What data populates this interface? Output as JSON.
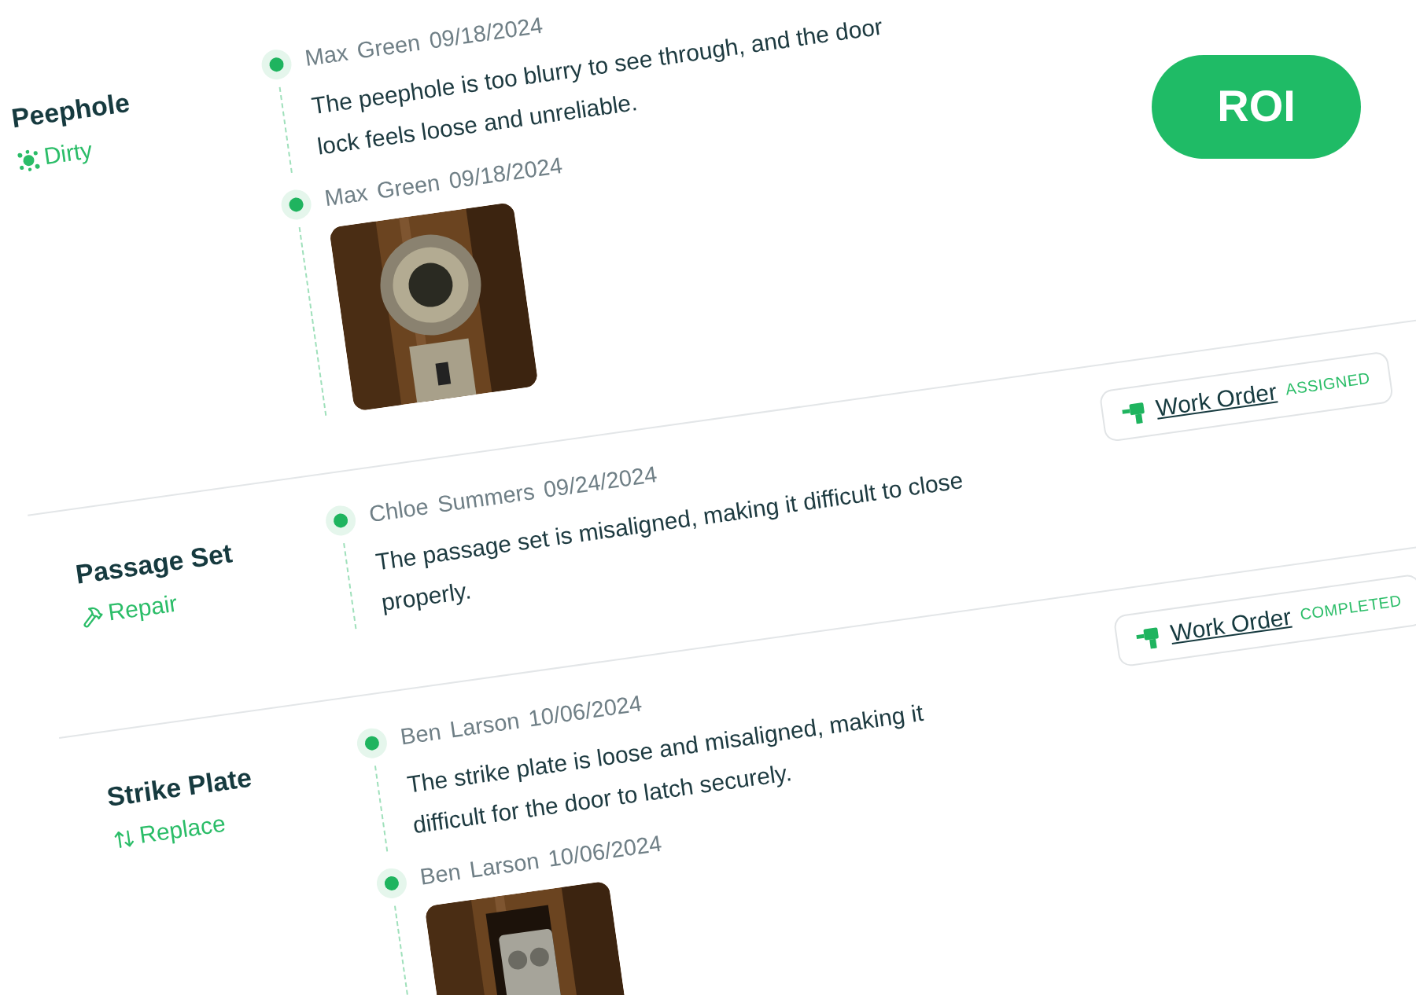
{
  "roi_button": {
    "label": "ROI"
  },
  "rows": [
    {
      "name": "Peephole",
      "tag": {
        "kind": "dirty",
        "label": "Dirty"
      },
      "entries": [
        {
          "kind": "comment",
          "author": "Max Green",
          "date": "09/18/2024",
          "text": "The peephole is too blurry to see through, and the door lock feels loose and unreliable."
        },
        {
          "author": "Max Green",
          "date": "09/18/2024"
        }
      ]
    },
    {
      "name": "Passage Set",
      "tag": {
        "kind": "repair",
        "label": "Repair"
      },
      "work_order": {
        "label": "Work Order",
        "status": "ASSIGNED"
      },
      "entries": [
        {
          "kind": "comment",
          "author": "Chloe Summers",
          "date": "09/24/2024",
          "text": "The passage set is misaligned, making it difficult to close properly."
        }
      ]
    },
    {
      "name": "Strike Plate",
      "tag": {
        "kind": "replace",
        "label": "Replace"
      },
      "work_order": {
        "label": "Work Order",
        "status": "COMPLETED"
      },
      "entries": [
        {
          "kind": "comment",
          "author": "Ben Larson",
          "date": "10/06/2024",
          "text": "The strike plate is loose and misaligned, making it difficult for the door to latch securely."
        },
        {
          "author": "Ben Larson",
          "date": "10/06/2024"
        }
      ]
    }
  ]
}
